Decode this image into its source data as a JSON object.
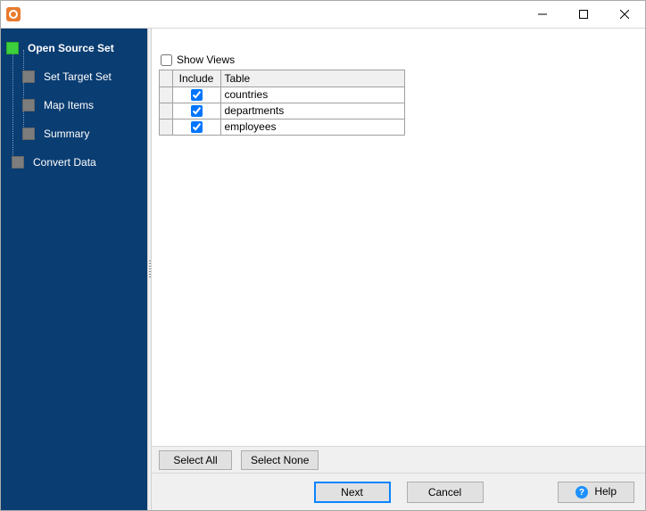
{
  "titlebar": {
    "title": ""
  },
  "sidebar": {
    "items": [
      {
        "label": "Open Source Set",
        "active": true
      },
      {
        "label": "Set Target Set",
        "active": false
      },
      {
        "label": "Map Items",
        "active": false
      },
      {
        "label": "Summary",
        "active": false
      },
      {
        "label": "Convert Data",
        "active": false
      }
    ]
  },
  "main": {
    "show_views_label": "Show Views",
    "show_views_checked": false,
    "columns": {
      "include": "Include",
      "table": "Table"
    },
    "rows": [
      {
        "include": true,
        "table": "countries"
      },
      {
        "include": true,
        "table": "departments"
      },
      {
        "include": true,
        "table": "employees"
      }
    ],
    "select_all": "Select All",
    "select_none": "Select None"
  },
  "footer": {
    "next": "Next",
    "cancel": "Cancel",
    "help": "Help"
  }
}
